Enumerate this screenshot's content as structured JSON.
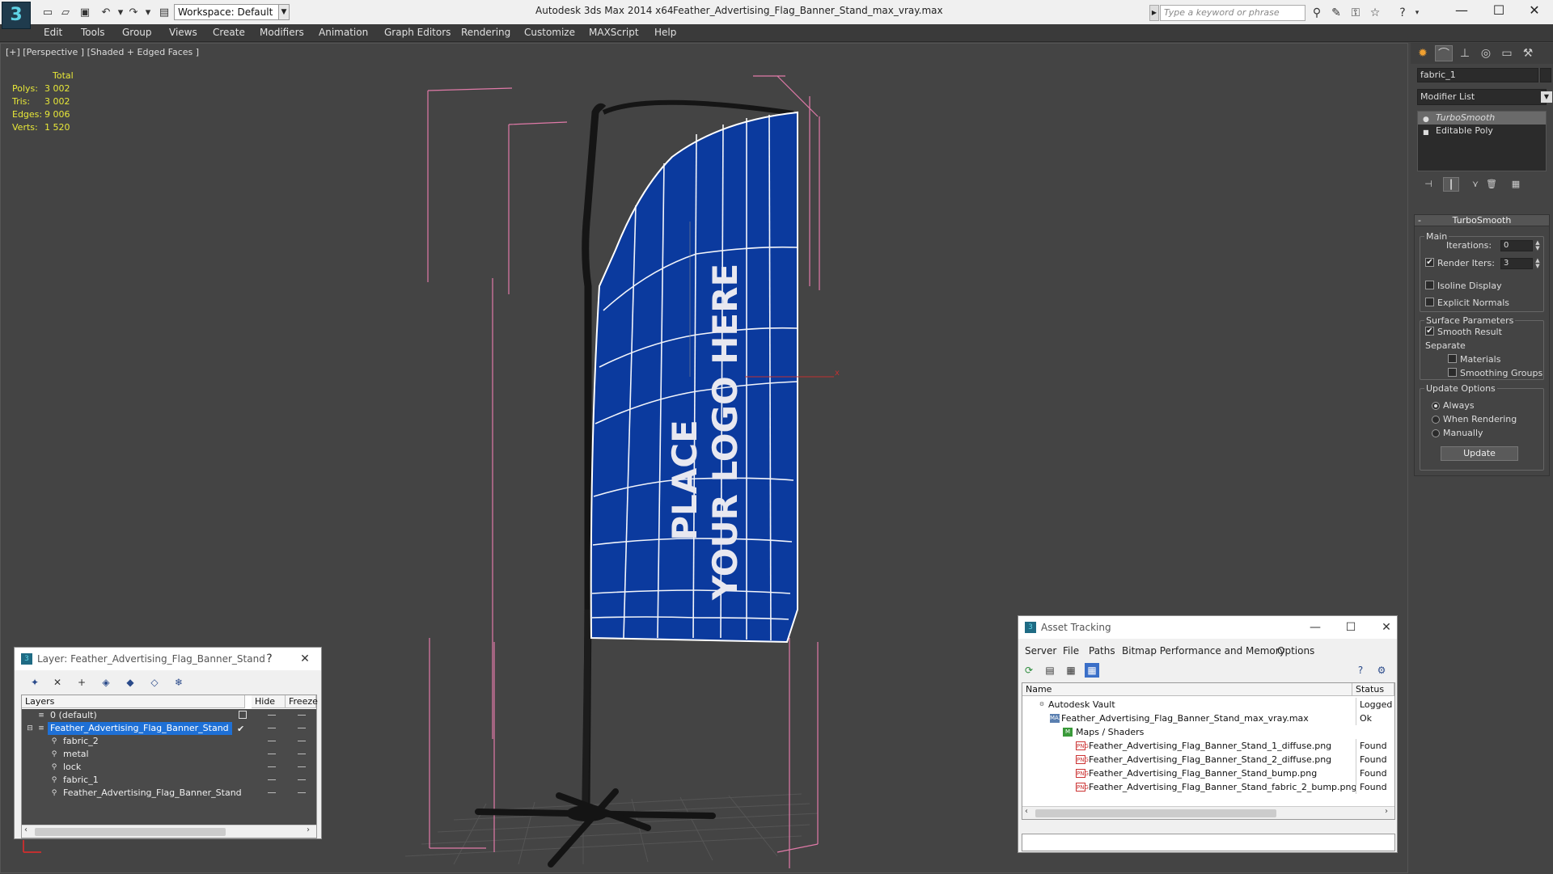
{
  "titlebar": {
    "app": "Autodesk 3ds Max  2014 x64",
    "file": "Feather_Advertising_Flag_Banner_Stand_max_vray.max",
    "workspace": "Workspace: Default",
    "search_placeholder": "Type a keyword or phrase"
  },
  "menu": [
    "Edit",
    "Tools",
    "Group",
    "Views",
    "Create",
    "Modifiers",
    "Animation",
    "Graph Editors",
    "Rendering",
    "Customize",
    "MAXScript",
    "Help"
  ],
  "viewport": {
    "label": "[+] [Perspective ] [Shaded + Edged Faces ]",
    "stats_header": "Total",
    "stats": [
      {
        "k": "Polys:",
        "v": "3 002"
      },
      {
        "k": "Tris:",
        "v": "3 002"
      },
      {
        "k": "Edges:",
        "v": "9 006"
      },
      {
        "k": "Verts:",
        "v": "1 520"
      }
    ],
    "flag_text_line1": "PLACE",
    "flag_text_line2": "YOUR LOGO HERE",
    "colors": {
      "flag": "#0b3a9e",
      "bbox": "#e07aa8",
      "grid": "#555555"
    }
  },
  "command_panel": {
    "object_name": "fabric_1",
    "modifier_list": "Modifier List",
    "stack": [
      "TurboSmooth",
      "Editable Poly"
    ],
    "rollout": {
      "title": "TurboSmooth",
      "main": "Main",
      "iterations_label": "Iterations:",
      "iterations": "0",
      "render_iters_label": "Render Iters:",
      "render_iters": "3",
      "isoline": "Isoline Display",
      "explicit": "Explicit Normals",
      "surface": "Surface Parameters",
      "smooth_result": "Smooth Result",
      "separate": "Separate",
      "materials": "Materials",
      "smoothing_groups": "Smoothing Groups",
      "update_options": "Update Options",
      "always": "Always",
      "when_rendering": "When Rendering",
      "manually": "Manually",
      "update": "Update"
    }
  },
  "layer_dialog": {
    "title": "Layer: Feather_Advertising_Flag_Banner_Stand",
    "help": "?",
    "col_layers": "Layers",
    "col_hide": "Hide",
    "col_freeze": "Freeze",
    "rows": [
      {
        "name": "0 (default)",
        "indent": 1
      },
      {
        "name": "Feather_Advertising_Flag_Banner_Stand",
        "indent": 1
      },
      {
        "name": "fabric_2",
        "indent": 2
      },
      {
        "name": "metal",
        "indent": 2
      },
      {
        "name": "lock",
        "indent": 2
      },
      {
        "name": "fabric_1",
        "indent": 2
      },
      {
        "name": "Feather_Advertising_Flag_Banner_Stand",
        "indent": 2
      }
    ]
  },
  "asset_dialog": {
    "title": "Asset Tracking",
    "menu": [
      "Server",
      "File",
      "Paths",
      "Bitmap Performance and Memory",
      "Options"
    ],
    "col_name": "Name",
    "col_status": "Status",
    "rows": [
      {
        "name": "Autodesk Vault",
        "status": "Logged Out",
        "indent": 1
      },
      {
        "name": "Feather_Advertising_Flag_Banner_Stand_max_vray.max",
        "status": "Ok",
        "indent": 2
      },
      {
        "name": "Maps / Shaders",
        "status": "",
        "indent": 3
      },
      {
        "name": "Feather_Advertising_Flag_Banner_Stand_1_diffuse.png",
        "status": "Found",
        "indent": 4
      },
      {
        "name": "Feather_Advertising_Flag_Banner_Stand_2_diffuse.png",
        "status": "Found",
        "indent": 4
      },
      {
        "name": "Feather_Advertising_Flag_Banner_Stand_bump.png",
        "status": "Found",
        "indent": 4
      },
      {
        "name": "Feather_Advertising_Flag_Banner_Stand_fabric_2_bump.png",
        "status": "Found",
        "indent": 4
      }
    ]
  }
}
